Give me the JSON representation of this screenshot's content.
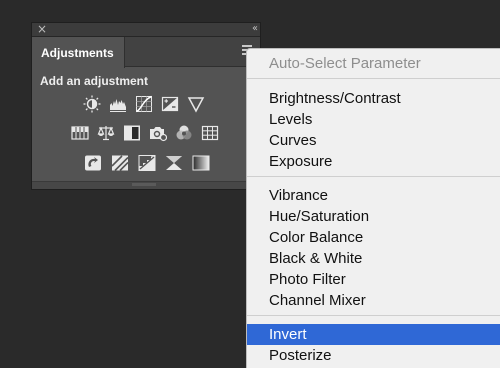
{
  "panel": {
    "close_glyph": "×",
    "collapse_glyph": "‹‹",
    "tab_label": "Adjustments",
    "section_label": "Add an adjustment",
    "icons_row1": [
      "brightness-contrast-icon",
      "levels-icon",
      "curves-icon",
      "exposure-icon",
      "vibrance-icon"
    ],
    "icons_row2": [
      "hue-saturation-icon",
      "color-balance-icon",
      "black-white-icon",
      "photo-filter-icon",
      "channel-mixer-icon",
      "color-lookup-icon"
    ],
    "icons_row3": [
      "invert-icon",
      "posterize-icon",
      "threshold-icon",
      "selective-color-icon",
      "gradient-map-icon"
    ]
  },
  "menu": {
    "items": [
      {
        "label": "Auto-Select Parameter",
        "disabled": true
      },
      {
        "label": "Brightness/Contrast"
      },
      {
        "label": "Levels"
      },
      {
        "label": "Curves"
      },
      {
        "label": "Exposure"
      },
      {
        "label": "Vibrance"
      },
      {
        "label": "Hue/Saturation"
      },
      {
        "label": "Color Balance"
      },
      {
        "label": "Black & White"
      },
      {
        "label": "Photo Filter"
      },
      {
        "label": "Channel Mixer"
      },
      {
        "label": "Invert",
        "selected": true
      },
      {
        "label": "Posterize"
      }
    ]
  },
  "colors": {
    "selection": "#2f68d6",
    "panel_bg": "#535353",
    "menu_bg": "#f0f0f0"
  }
}
